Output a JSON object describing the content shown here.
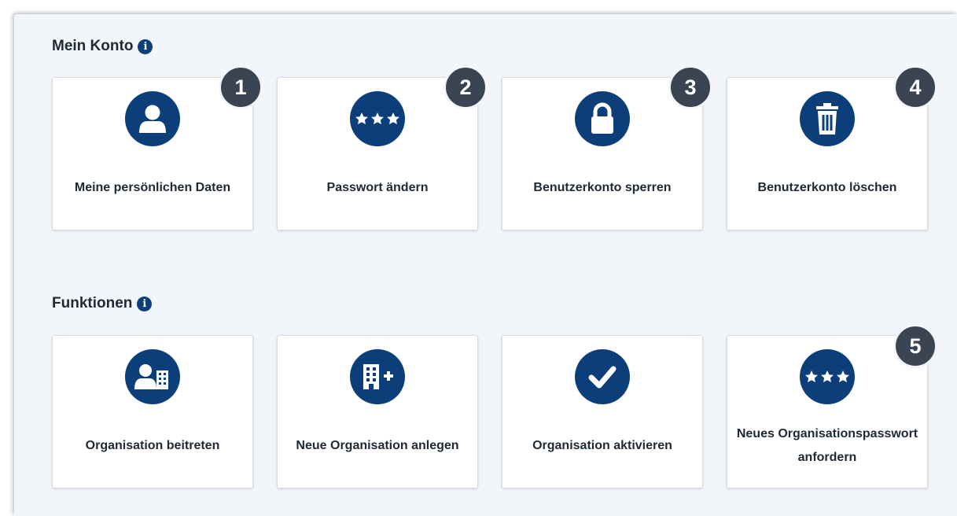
{
  "sections": [
    {
      "title": "Mein Konto",
      "info_icon": "i",
      "cards": [
        {
          "label": "Meine persönlichen Daten",
          "icon": "user-icon",
          "badge": "1"
        },
        {
          "label": "Passwort ändern",
          "icon": "password-stars-icon",
          "badge": "2"
        },
        {
          "label": "Benutzerkonto sperren",
          "icon": "lock-icon",
          "badge": "3"
        },
        {
          "label": "Benutzerkonto löschen",
          "icon": "trash-icon",
          "badge": "4"
        }
      ]
    },
    {
      "title": "Funktionen",
      "info_icon": "i",
      "cards": [
        {
          "label": "Organisation beitreten",
          "icon": "user-building-icon"
        },
        {
          "label": "Neue Organisation anlegen",
          "icon": "building-plus-icon"
        },
        {
          "label": "Organisation aktivieren",
          "icon": "check-icon"
        },
        {
          "label": "Neues Organisationspasswort anfordern",
          "icon": "password-stars-icon",
          "badge": "5"
        }
      ]
    }
  ],
  "colors": {
    "accent": "#0c3f7a",
    "badge": "#3b4453",
    "panel_bg": "#f2f5f9",
    "card_bg": "#ffffff",
    "text": "#1f2933"
  }
}
